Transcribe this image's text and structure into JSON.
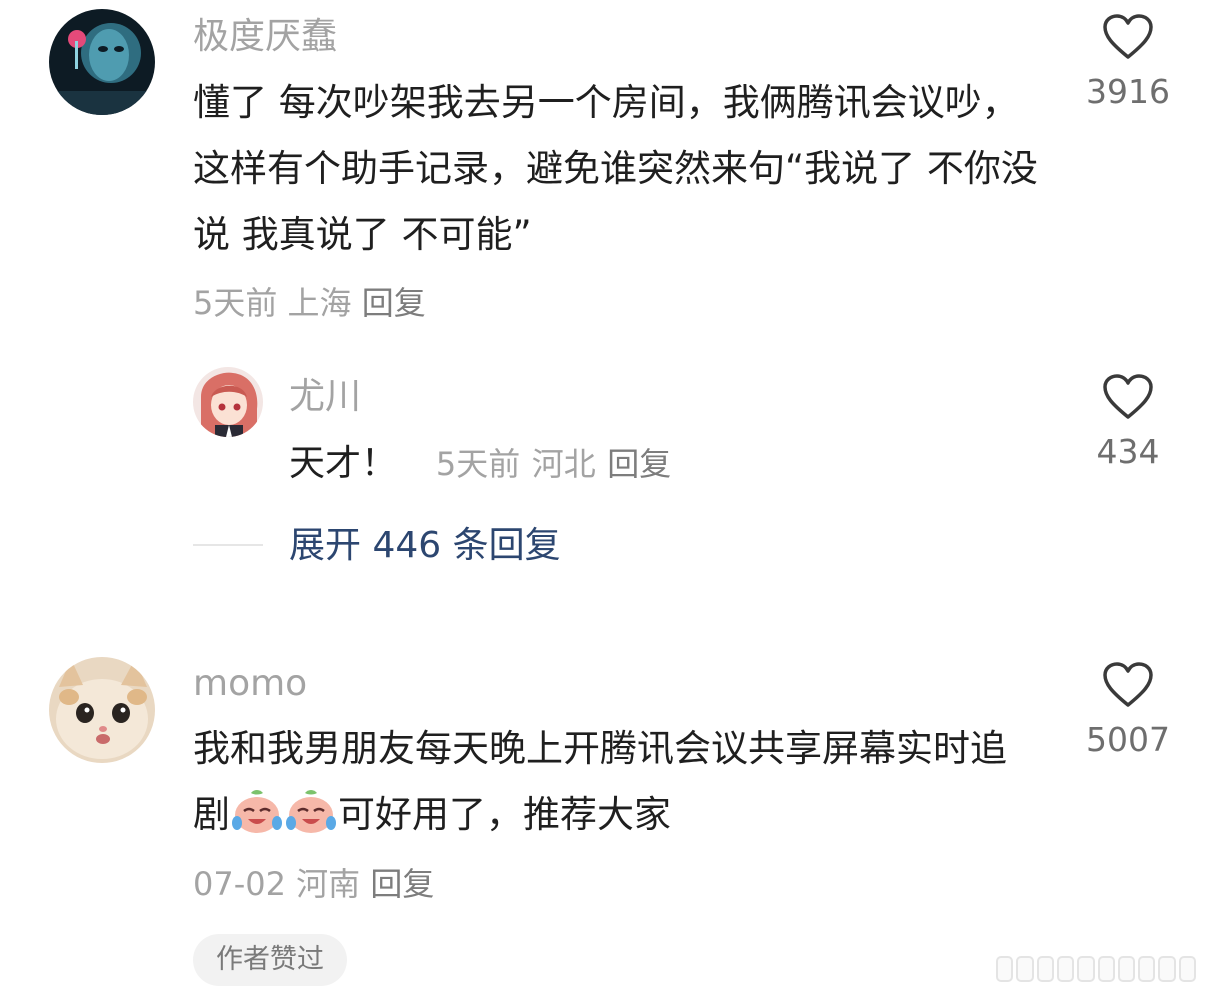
{
  "comments": [
    {
      "username": "极度厌蠢",
      "text": "懂了 每次吵架我去另一个房间，我俩腾讯会议吵，这样有个助手记录，避免谁突然来句“我说了 不你没说  我真说了  不可能”",
      "time": "5天前",
      "location": "上海",
      "reply_label": "回复",
      "like_count": "3916",
      "avatar_icon": "portrait-avatar-icon",
      "replies": [
        {
          "username": "尤川",
          "text": "天才！",
          "time": "5天前",
          "location": "河北",
          "reply_label": "回复",
          "like_count": "434",
          "avatar_icon": "anime-girl-avatar-icon"
        }
      ],
      "expand_label": "展开 446 条回复"
    },
    {
      "username": "momo",
      "text_part1": "我和我男朋友每天晚上开腾讯会议共享屏幕实时追剧",
      "text_part2": "可好用了，推荐大家",
      "emoji": "crying-laughing-emoji",
      "time": "07-02",
      "location": "河南",
      "reply_label": "回复",
      "like_count": "5007",
      "avatar_icon": "cat-avatar-icon",
      "author_badge": "作者赞过"
    }
  ],
  "colors": {
    "meta": "#a3a3a3",
    "link": "#2c4670",
    "text": "#1f1f1f"
  }
}
